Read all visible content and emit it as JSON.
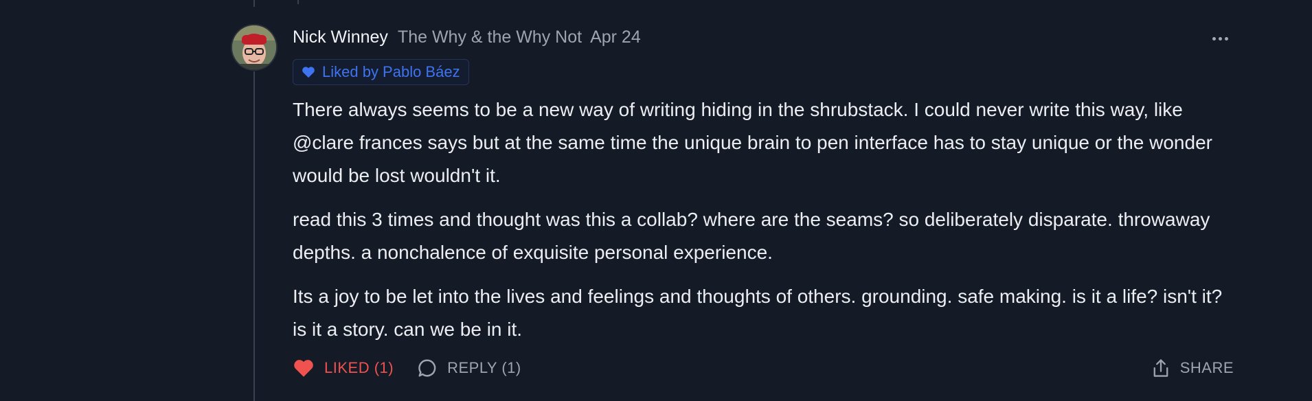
{
  "comment": {
    "author": "Nick Winney",
    "publication": "The Why & the Why Not",
    "date": "Apr 24",
    "liked_by": "Liked by Pablo Báez",
    "paragraphs": [
      "There always seems to be a new way of writing hiding in the shrubstack. I could never write this way, like @clare frances says but at the same time the unique brain to pen interface has to stay unique or the wonder would be lost wouldn't it.",
      "read this 3 times and thought was this a collab? where are the seams? so deliberately disparate. throwaway depths. a nonchalence of exquisite personal experience.",
      "Its a joy to be let into the lives and feelings and thoughts of others. grounding. safe making. is it a life? isn't it? is it a story. can we be in it."
    ]
  },
  "actions": {
    "like_label": "LIKED (1)",
    "reply_label": "REPLY (1)",
    "share_label": "SHARE"
  },
  "icons": {
    "more": "more-horizontal-icon",
    "liked_badge": "heart-icon",
    "like": "heart-filled-icon",
    "reply": "speech-bubble-icon",
    "share": "share-upload-icon"
  },
  "colors": {
    "background": "#141a26",
    "liked_red": "#f0524f",
    "liked_by_blue": "#3e74f0",
    "muted_text": "#9ea4b0"
  }
}
